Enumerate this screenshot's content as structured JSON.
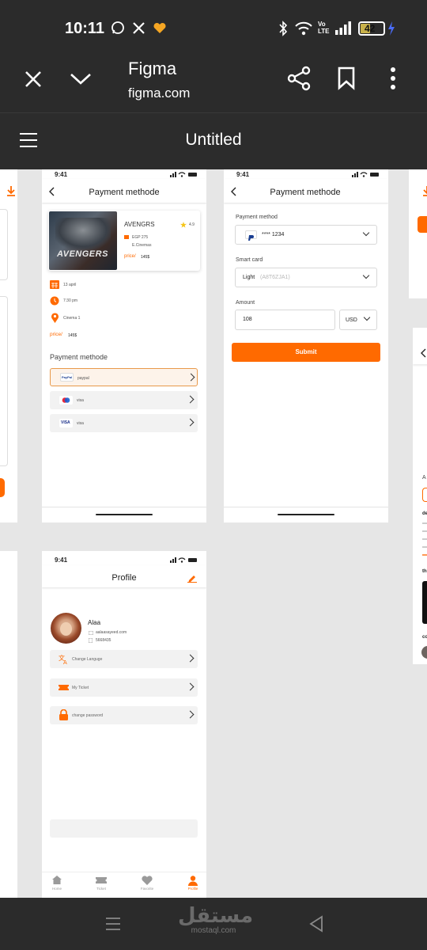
{
  "status": {
    "time": "10:11",
    "battery": "42",
    "network": "Vo LTE"
  },
  "browser": {
    "title": "Figma",
    "url": "figma.com"
  },
  "figma": {
    "file_title": "Untitled"
  },
  "payment1": {
    "time": "9:41",
    "title": "Payment methode",
    "movie": {
      "name": "AVENGRS",
      "rating": "4.9",
      "price_label": "EGP 275",
      "cinema": "E.Cinemas",
      "poster_text": "AVENGERS",
      "price_small_label": "price/",
      "price_small_value": "145$"
    },
    "details": {
      "date": "13 april",
      "time": "7:30 pm",
      "cinema": "Cinema 1"
    },
    "price_label": "price/",
    "price_value": "145$",
    "section_title": "Payment methode",
    "methods": [
      {
        "label": "paypal",
        "badge": "PayPal"
      },
      {
        "label": "visa",
        "badge": ""
      },
      {
        "label": "visa",
        "badge": "VISA"
      }
    ]
  },
  "payment2": {
    "time": "9:41",
    "title": "Payment methode",
    "payment_method_label": "Payment method",
    "payment_method_value": "**** 1234",
    "smart_card_label": "Smart card",
    "smart_card_value": "Light",
    "smart_card_hint": "(A8T6ZJA1)",
    "amount_label": "Amount",
    "amount_value": "108",
    "currency": "USD",
    "submit_label": "Submit"
  },
  "profile": {
    "time": "9:41",
    "title": "Profile",
    "name": "Alaa",
    "email": "aalaasayeed.com",
    "phone": "5668435",
    "menu": [
      {
        "label": "Change Languge"
      },
      {
        "label": "My Ticket"
      },
      {
        "label": "change password"
      }
    ],
    "tabs": [
      {
        "label": "Home"
      },
      {
        "label": "Ticket"
      },
      {
        "label": "Favorite"
      },
      {
        "label": "Profile"
      }
    ]
  },
  "right_fragment": {
    "letters": [
      "A",
      "de",
      "th",
      "co"
    ]
  },
  "watermark": {
    "text": "مستقل",
    "sub": "mostaql.com"
  },
  "colors": {
    "accent": "#ff6a00",
    "chrome": "#2b2b2b",
    "canvas": "#e6e6e6"
  }
}
